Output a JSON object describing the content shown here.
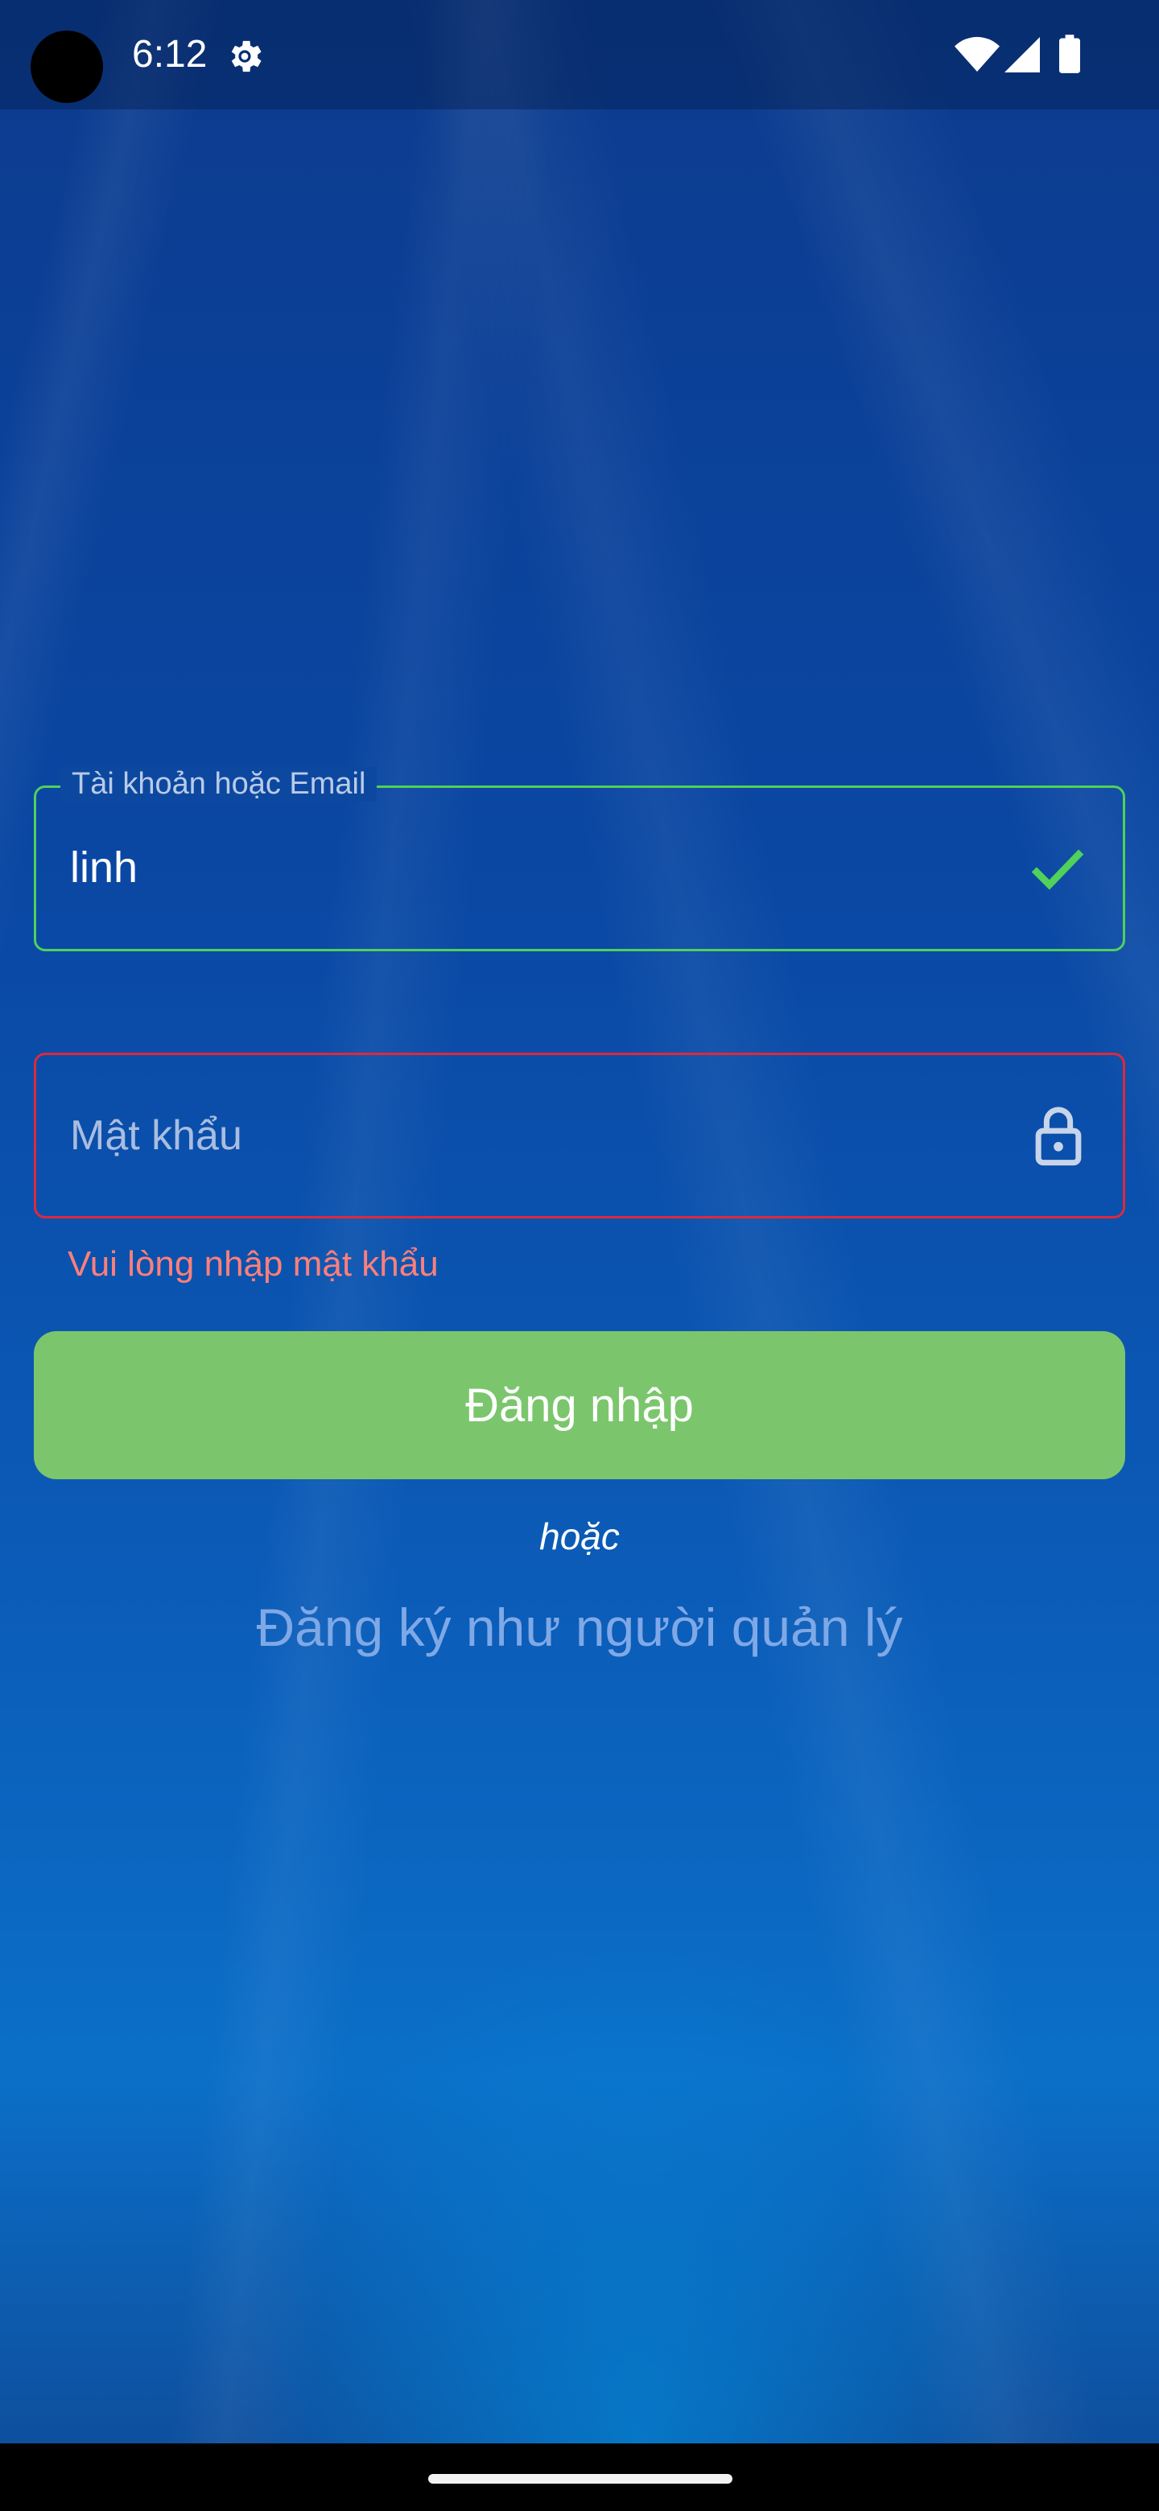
{
  "status_bar": {
    "time": "6:12",
    "icons": [
      "gear-icon",
      "wifi-icon",
      "signal-icon",
      "battery-icon"
    ]
  },
  "login_form": {
    "account_field": {
      "label": "Tài khoản hoặc Email",
      "value": "linh",
      "status": "valid",
      "icon": "check-icon"
    },
    "password_field": {
      "placeholder": "Mật khẩu",
      "value": "",
      "status": "error",
      "icon": "lock-icon",
      "error": "Vui lòng nhập mật khẩu"
    },
    "login_button": "Đăng nhập",
    "or_label": "hoặc",
    "register_link": "Đăng ký như người quản lý"
  },
  "colors": {
    "valid_border": "#4fd15a",
    "error_border": "#e0283b",
    "error_text": "#ff7f7a",
    "button_bg": "#7bc66c",
    "link_text": "#7fa8e6"
  }
}
